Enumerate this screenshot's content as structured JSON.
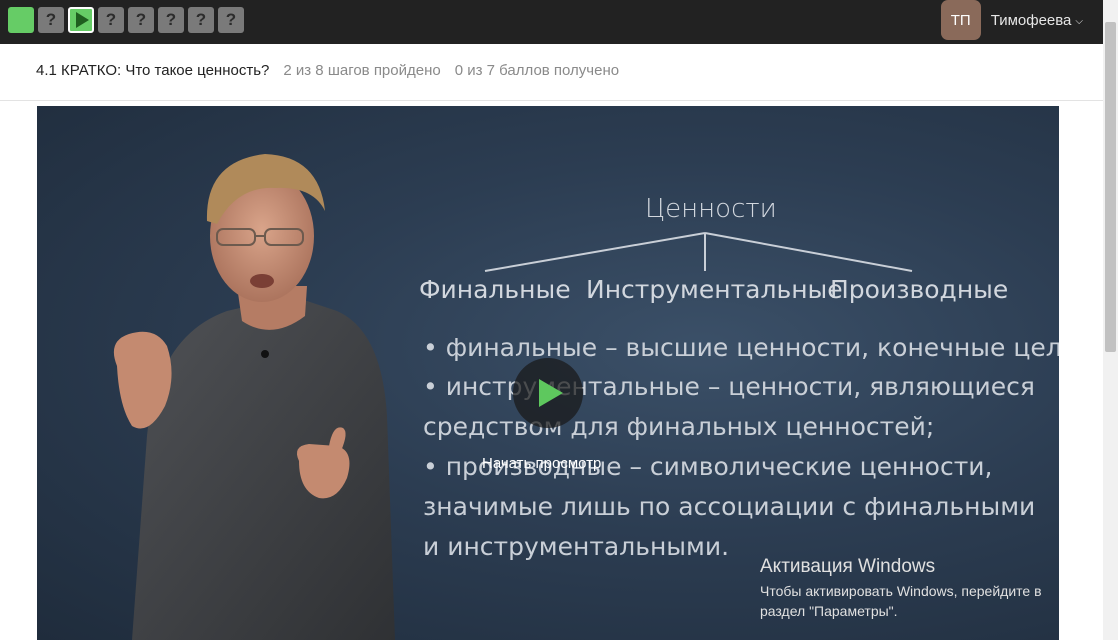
{
  "steps": [
    {
      "label": "",
      "state": "done"
    },
    {
      "label": "?",
      "state": "todo"
    },
    {
      "label": "",
      "state": "current",
      "icon": "play-icon"
    },
    {
      "label": "?",
      "state": "todo"
    },
    {
      "label": "?",
      "state": "todo"
    },
    {
      "label": "?",
      "state": "todo"
    },
    {
      "label": "?",
      "state": "todo"
    },
    {
      "label": "?",
      "state": "todo"
    }
  ],
  "user": {
    "initials": "ТП",
    "name": "Тимофеева"
  },
  "lesson": {
    "title": "4.1 КРАТКО: Что такое ценность?",
    "progress": "2 из 8 шагов пройдено",
    "score": "0 из 7 баллов  получено"
  },
  "video": {
    "play_label": "Начать просмотр",
    "slide": {
      "title": "Ценности",
      "categories": [
        "Финальные",
        "Инструментальные",
        "Производные"
      ],
      "lines": [
        "• финальные – высшие ценности, конечные цели;",
        "• инструментальные – ценности, являющиеся",
        "средством для финальных ценностей;",
        "• производные  – символические ценности,",
        "значимые лишь по ассоциации с финальными",
        "и инструментальными."
      ]
    }
  },
  "watermark": {
    "title": "Активация Windows",
    "text": "Чтобы активировать Windows, перейдите в раздел \"Параметры\"."
  },
  "colors": {
    "accent": "#66cc66",
    "topbar": "#222222",
    "video_bg": "#2c3d52"
  }
}
